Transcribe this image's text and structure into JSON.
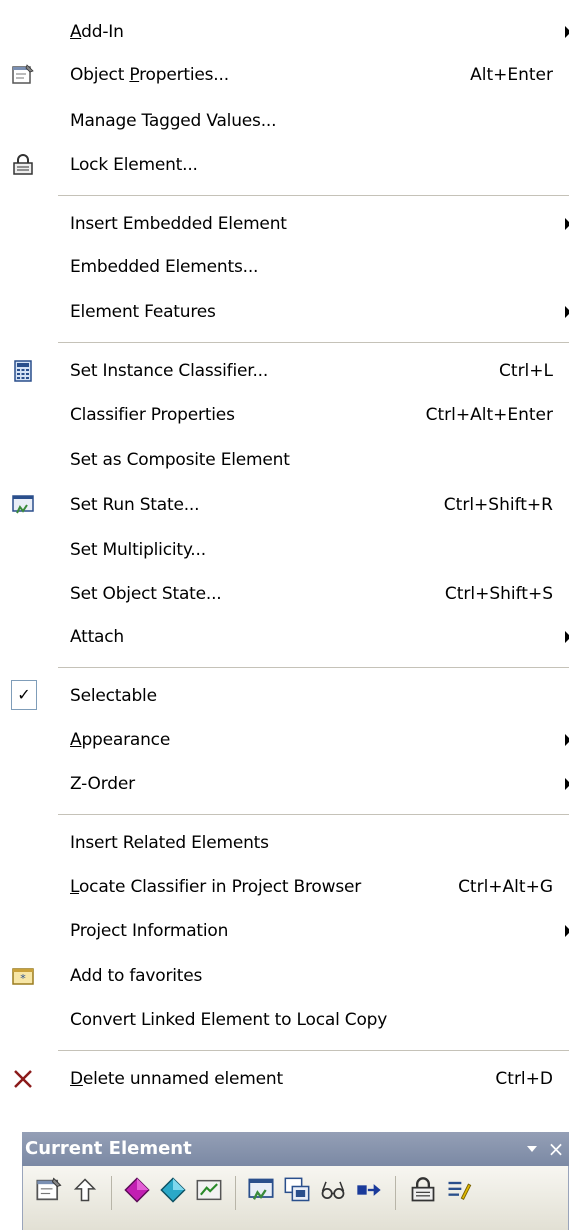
{
  "menu": {
    "items": [
      {
        "label": "Add-In",
        "mnemonic": "A",
        "submenu": true
      },
      {
        "label": "Object Properties...",
        "mnemonic": "P",
        "shortcut": "Alt+Enter",
        "icon": "properties-icon"
      },
      {
        "label": "Manage Tagged Values..."
      },
      {
        "label": "Lock Element...",
        "icon": "lock-icon"
      },
      {
        "label": "Insert Embedded Element",
        "submenu": true
      },
      {
        "label": "Embedded Elements..."
      },
      {
        "label": "Element Features",
        "submenu": true
      },
      {
        "label": "Set Instance Classifier...",
        "shortcut": "Ctrl+L",
        "icon": "classifier-icon"
      },
      {
        "label": "Classifier Properties",
        "shortcut": "Ctrl+Alt+Enter"
      },
      {
        "label": "Set as Composite Element"
      },
      {
        "label": "Set Run State...",
        "shortcut": "Ctrl+Shift+R",
        "icon": "run-state-icon"
      },
      {
        "label": "Set Multiplicity..."
      },
      {
        "label": "Set Object State...",
        "shortcut": "Ctrl+Shift+S"
      },
      {
        "label": "Attach",
        "submenu": true
      },
      {
        "label": "Selectable",
        "checked": true
      },
      {
        "label": "Appearance",
        "mnemonic": "A",
        "submenu": true
      },
      {
        "label": "Z-Order",
        "submenu": true
      },
      {
        "label": "Insert Related Elements"
      },
      {
        "label": "Locate Classifier in Project Browser",
        "mnemonic": "L",
        "shortcut": "Ctrl+Alt+G"
      },
      {
        "label": "Project Information",
        "submenu": true
      },
      {
        "label": "Add to favorites",
        "icon": "favorites-icon"
      },
      {
        "label": "Convert Linked Element to Local Copy"
      },
      {
        "label": "Delete unnamed element",
        "mnemonic": "D",
        "shortcut": "Ctrl+D",
        "icon": "delete-icon"
      }
    ],
    "check_glyph": "✓"
  },
  "toolwindow": {
    "title": "Current Element",
    "close_glyph": "×",
    "buttons": [
      "properties-icon",
      "up-arrow-icon",
      "magenta-gem-icon",
      "blue-gem-icon",
      "edit-diagram-icon",
      "run-state-icon",
      "child-diagram-icon",
      "glasses-icon",
      "link-arrow-icon",
      "lock-icon",
      "notes-icon"
    ]
  },
  "colors": {
    "menu_bg": "#ffffff",
    "separator": "#c5c2b8",
    "title_bar": "#8592ac",
    "toolbar_bg": "#ecebe3"
  }
}
